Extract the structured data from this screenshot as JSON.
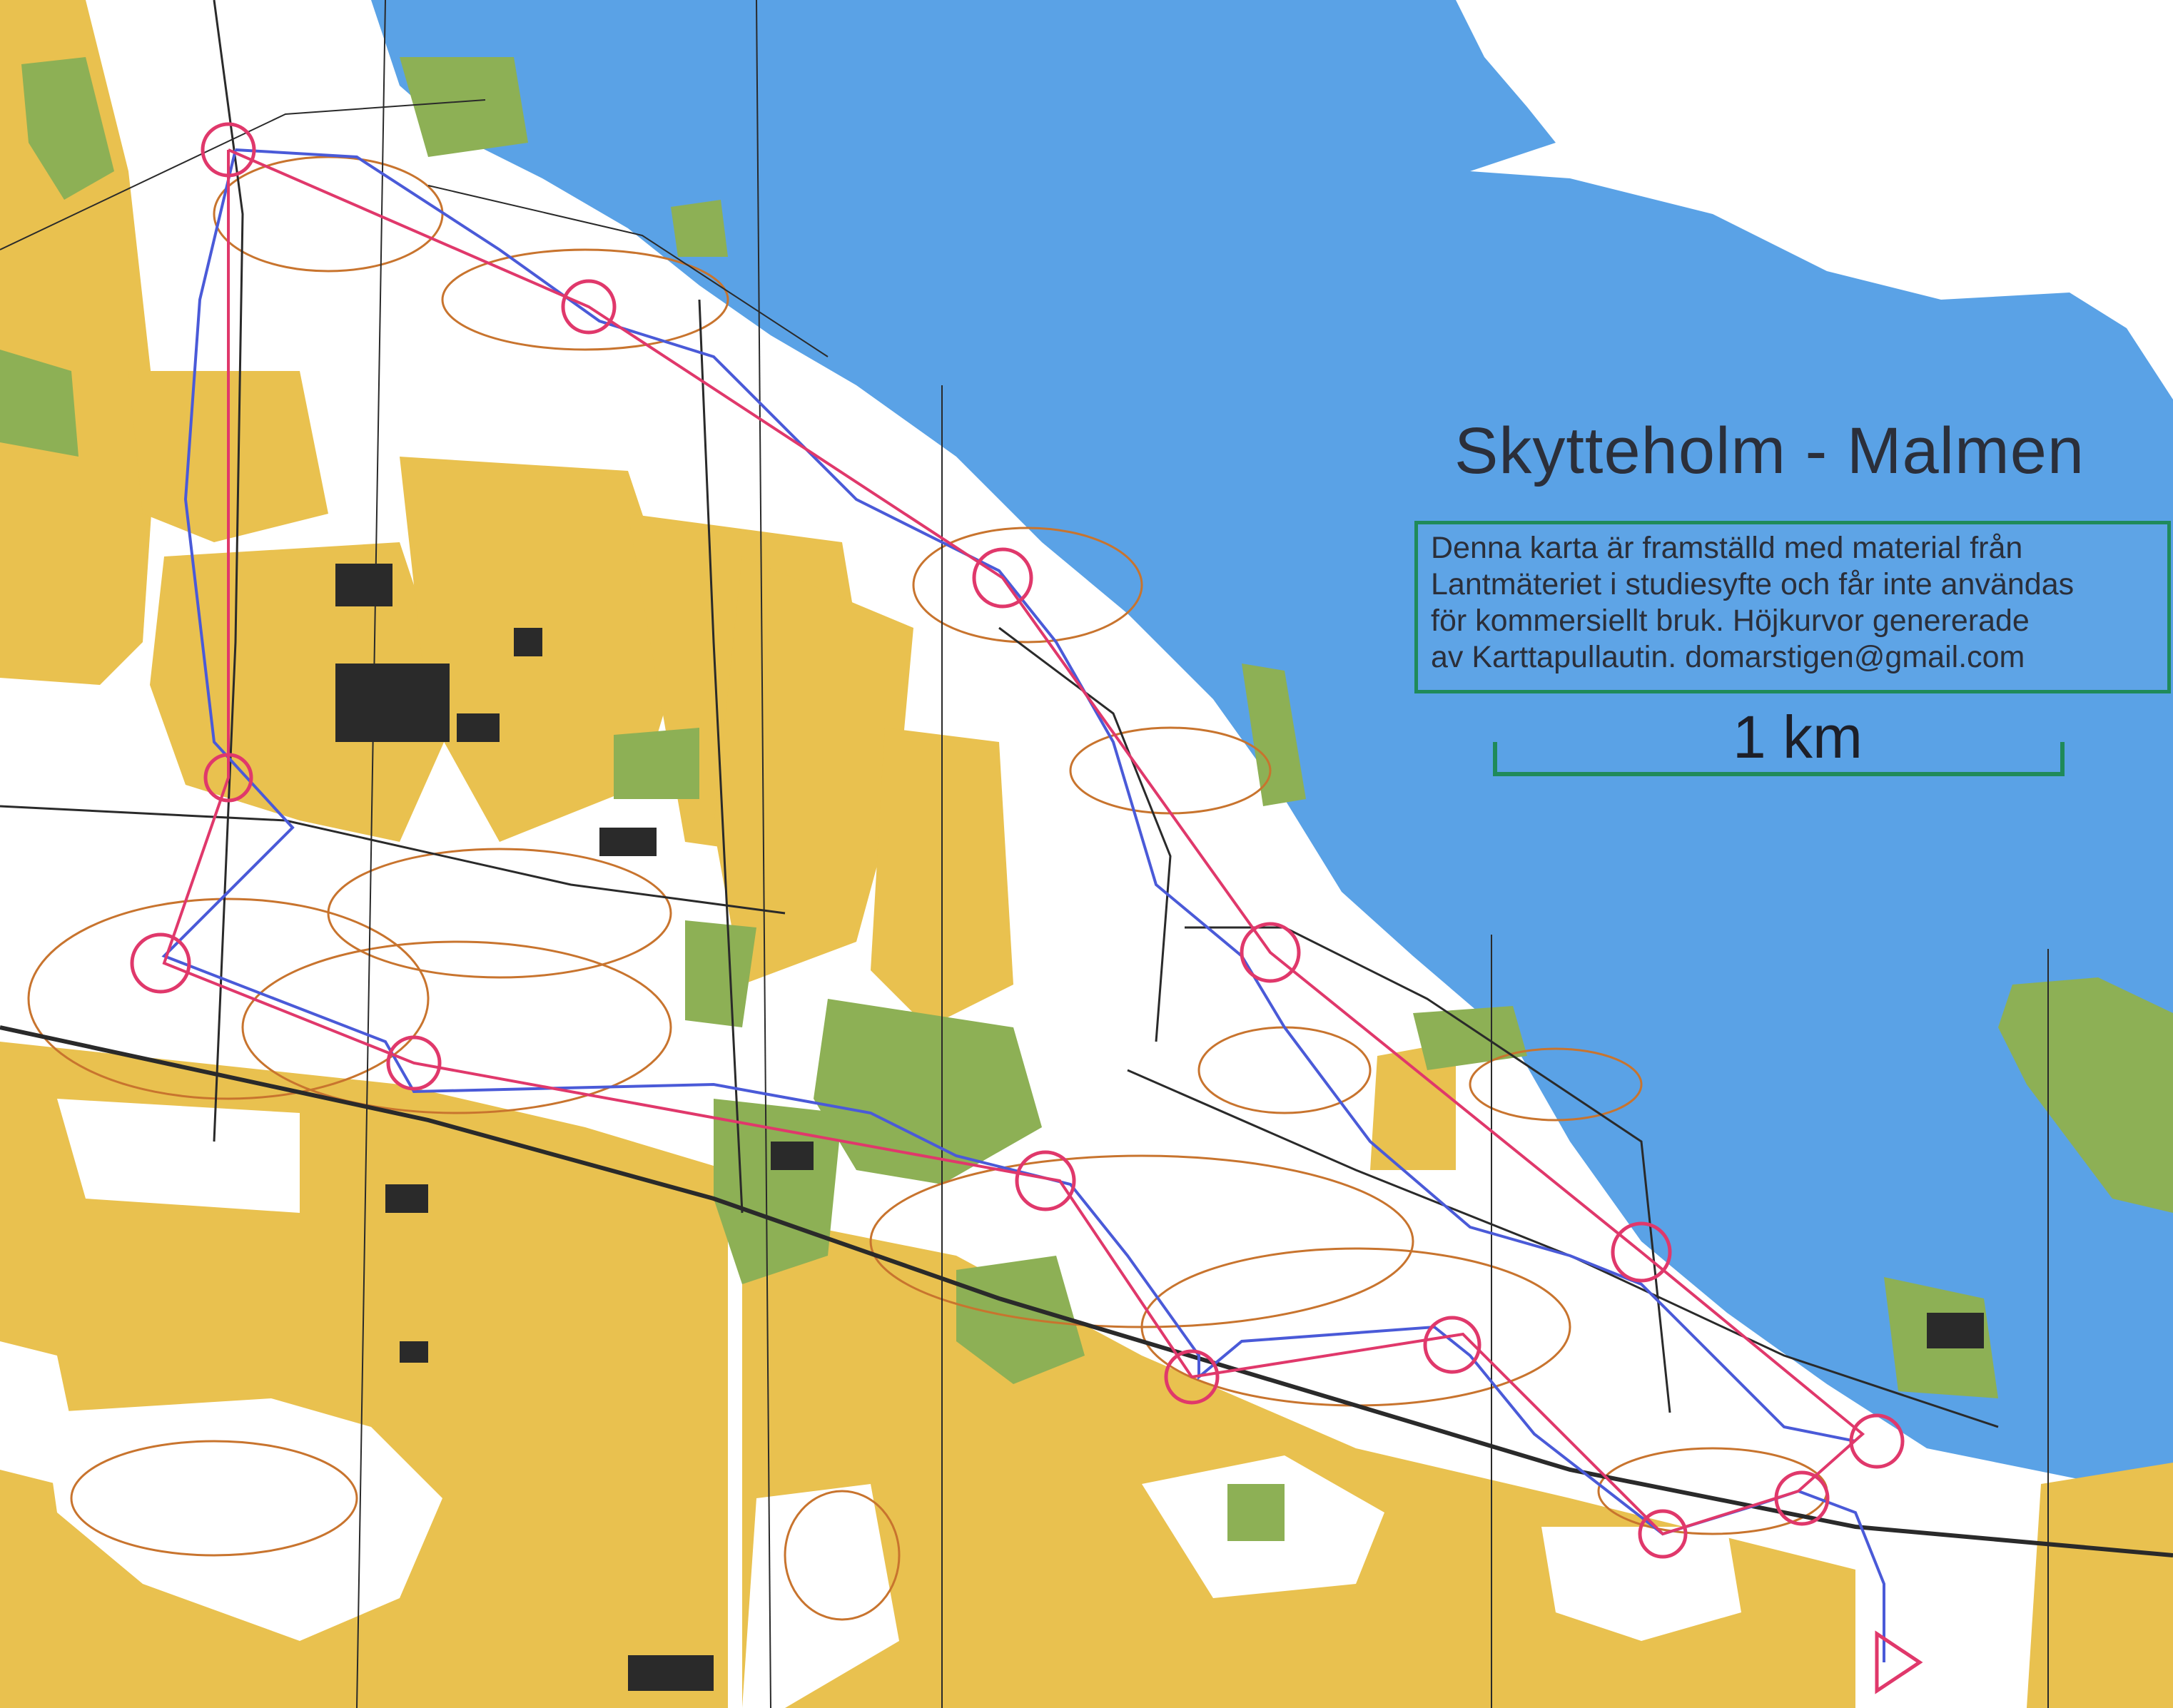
{
  "map": {
    "title": "Skytteholm - Malmen",
    "info_lines": [
      "Denna karta är framställd med material från",
      "Lantmäteriet i studiesyfte och får inte användas",
      "för kommersiellt bruk. Höjkurvor genererade",
      "av Karttapullautin. domarstigen@gmail.com"
    ],
    "scale_label": "1 km",
    "colors": {
      "water": "#5aa2e6",
      "open_land": "#e9c14f",
      "forest": "#ffffff",
      "green": "#8db055",
      "buildings": "#2a2a2a",
      "contours": "#c8742e",
      "course": "#e0386b",
      "route": "#4a5ad8",
      "scale_bar": "#1f8a5a"
    },
    "legend": {
      "controls_count": 15
    }
  }
}
